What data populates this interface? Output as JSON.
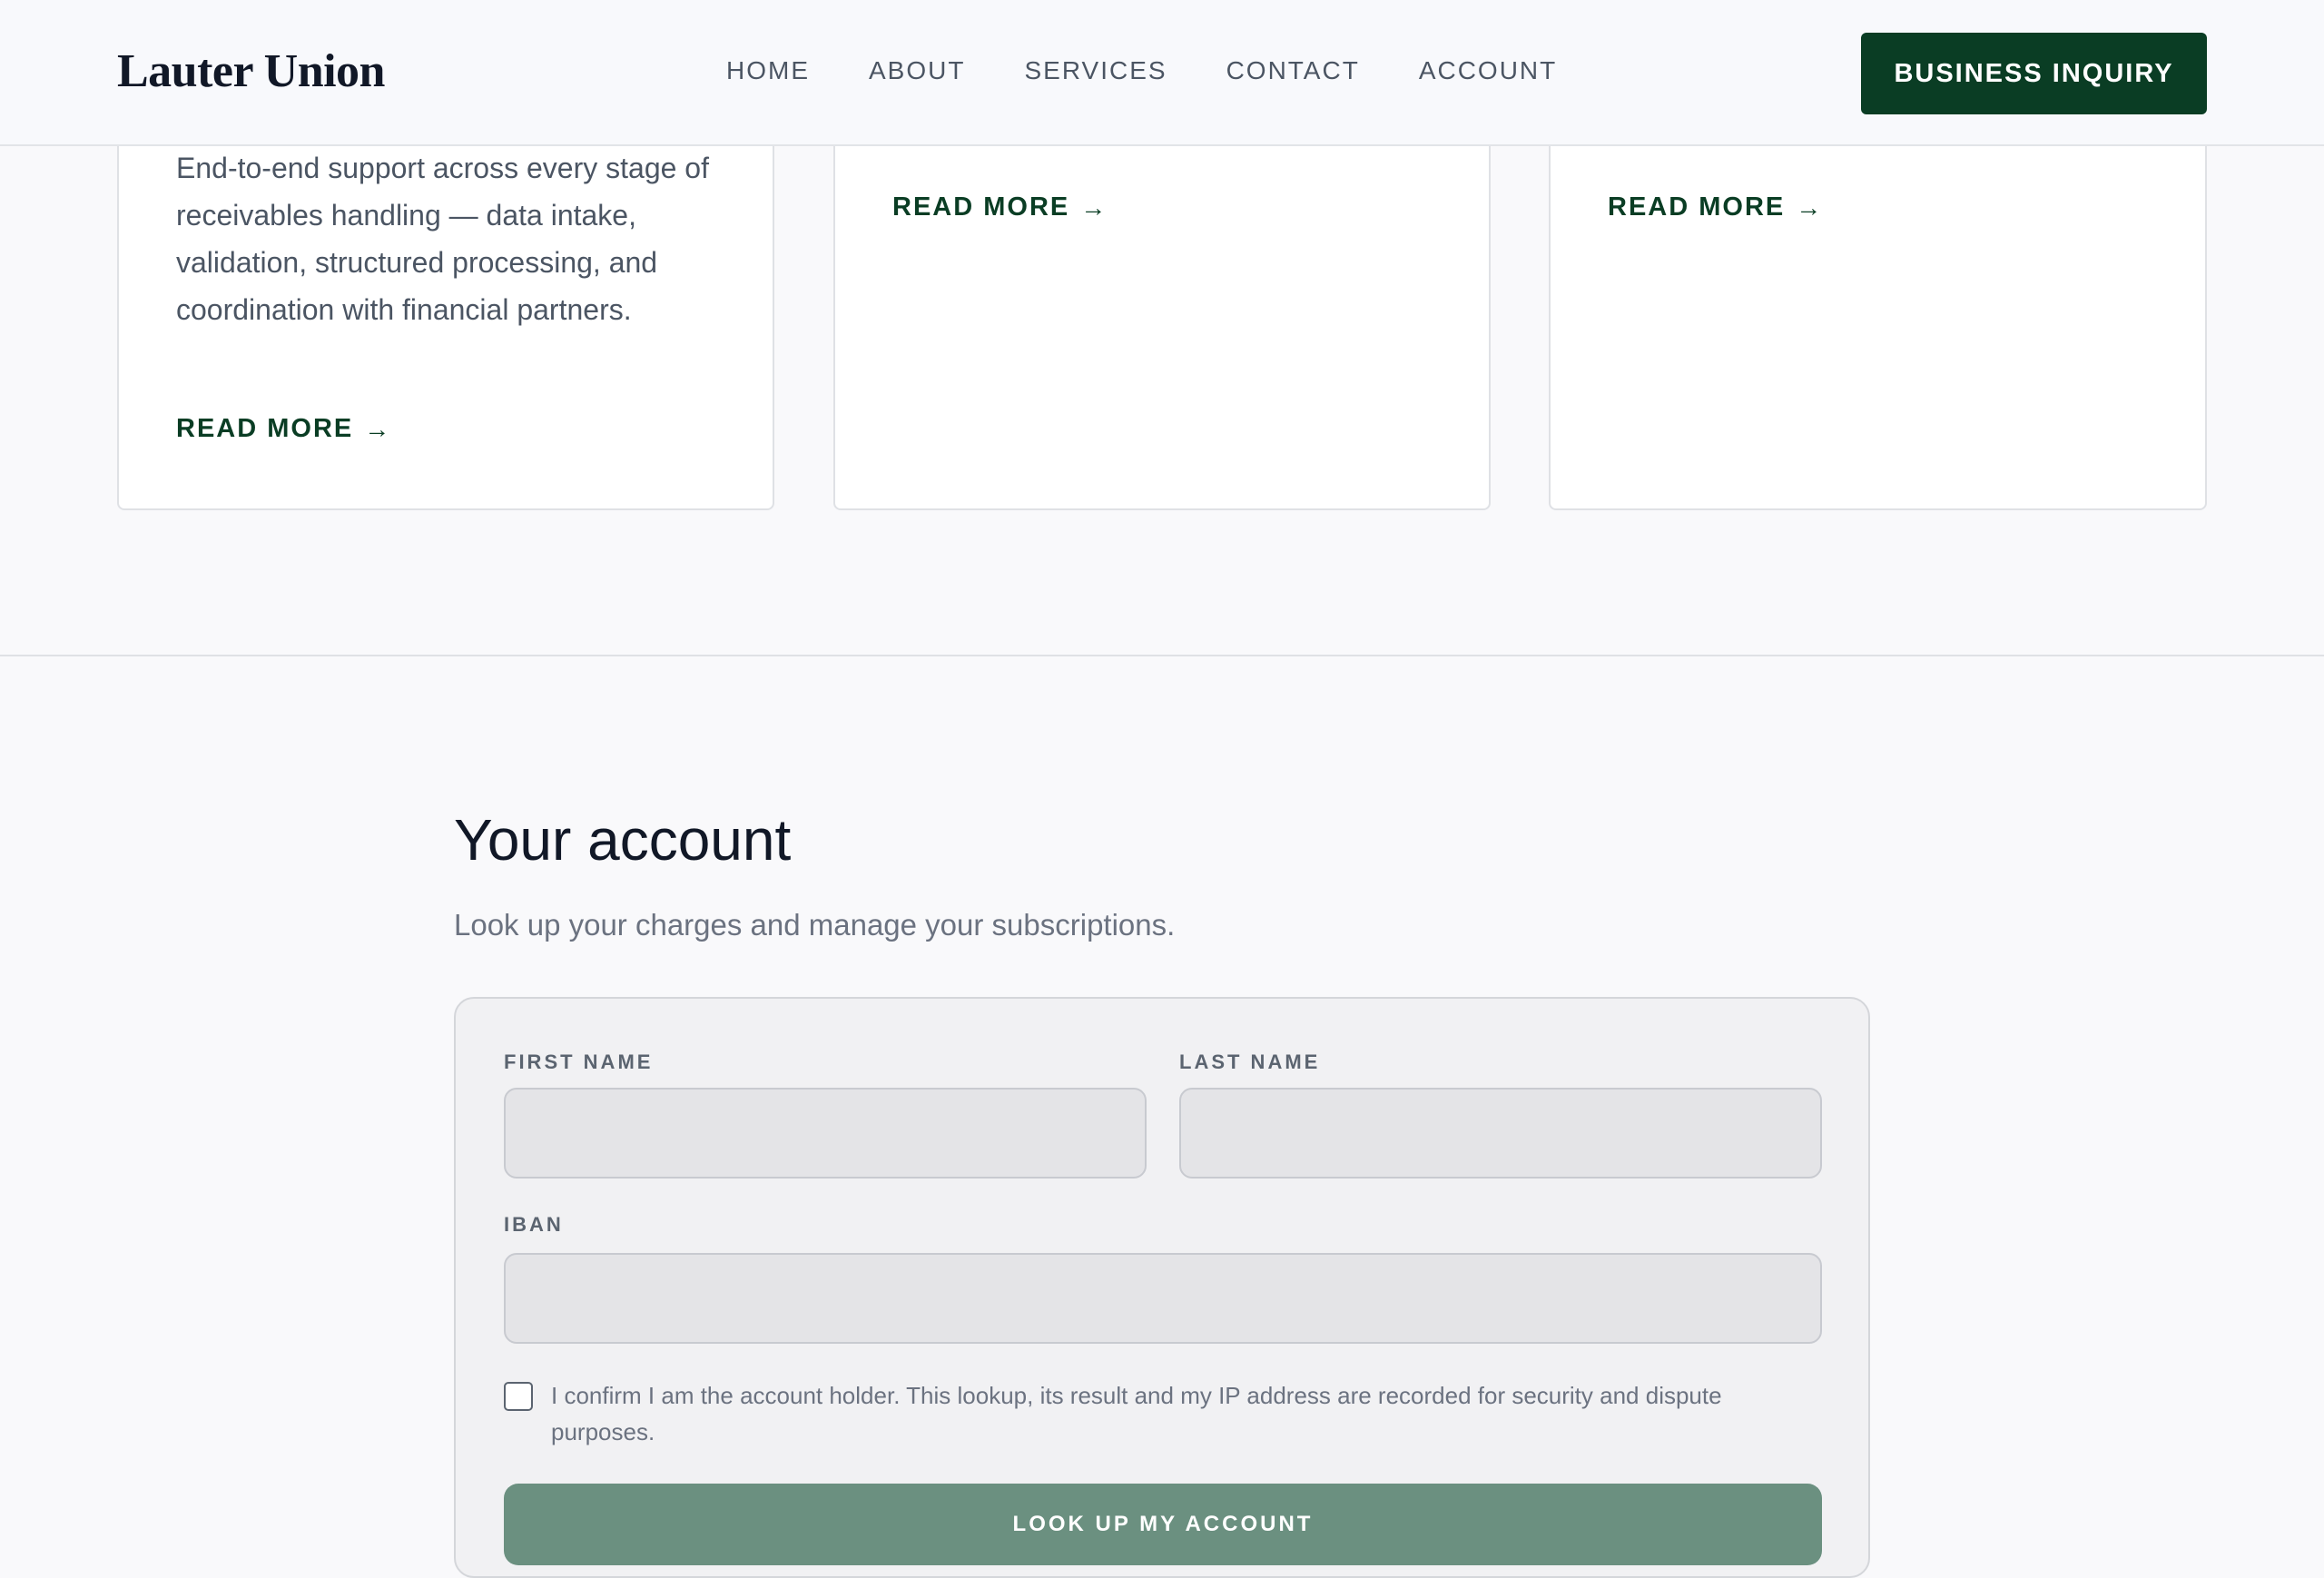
{
  "header": {
    "brand": "Lauter Union",
    "nav": [
      "HOME",
      "ABOUT",
      "SERVICES",
      "CONTACT",
      "ACCOUNT"
    ],
    "cta_label": "BUSINESS INQUIRY"
  },
  "services": {
    "cards": [
      {
        "text": "End-to-end support across every stage of receivables handling — data intake, validation, structured processing, and coordination with financial partners.",
        "link_label": "READ MORE",
        "arrow": "→"
      },
      {
        "link_label": "READ MORE",
        "arrow": "→"
      },
      {
        "link_label": "READ MORE",
        "arrow": "→"
      }
    ]
  },
  "account": {
    "title": "Your account",
    "subtitle": "Look up your charges and manage your subscriptions.",
    "form": {
      "first_name_label": "FIRST NAME",
      "first_name_value": "",
      "last_name_label": "LAST NAME",
      "last_name_value": "",
      "iban_label": "IBAN",
      "iban_value": "",
      "consent_checked": false,
      "consent_text": "I confirm I am the account holder. This lookup, its result and my IP address are recorded for security and dispute purposes.",
      "submit_label": "LOOK UP MY ACCOUNT"
    }
  },
  "colors": {
    "brand_green": "#0a3d24",
    "submit_green": "#6b9080",
    "page_bg": "#f9f9fb"
  }
}
